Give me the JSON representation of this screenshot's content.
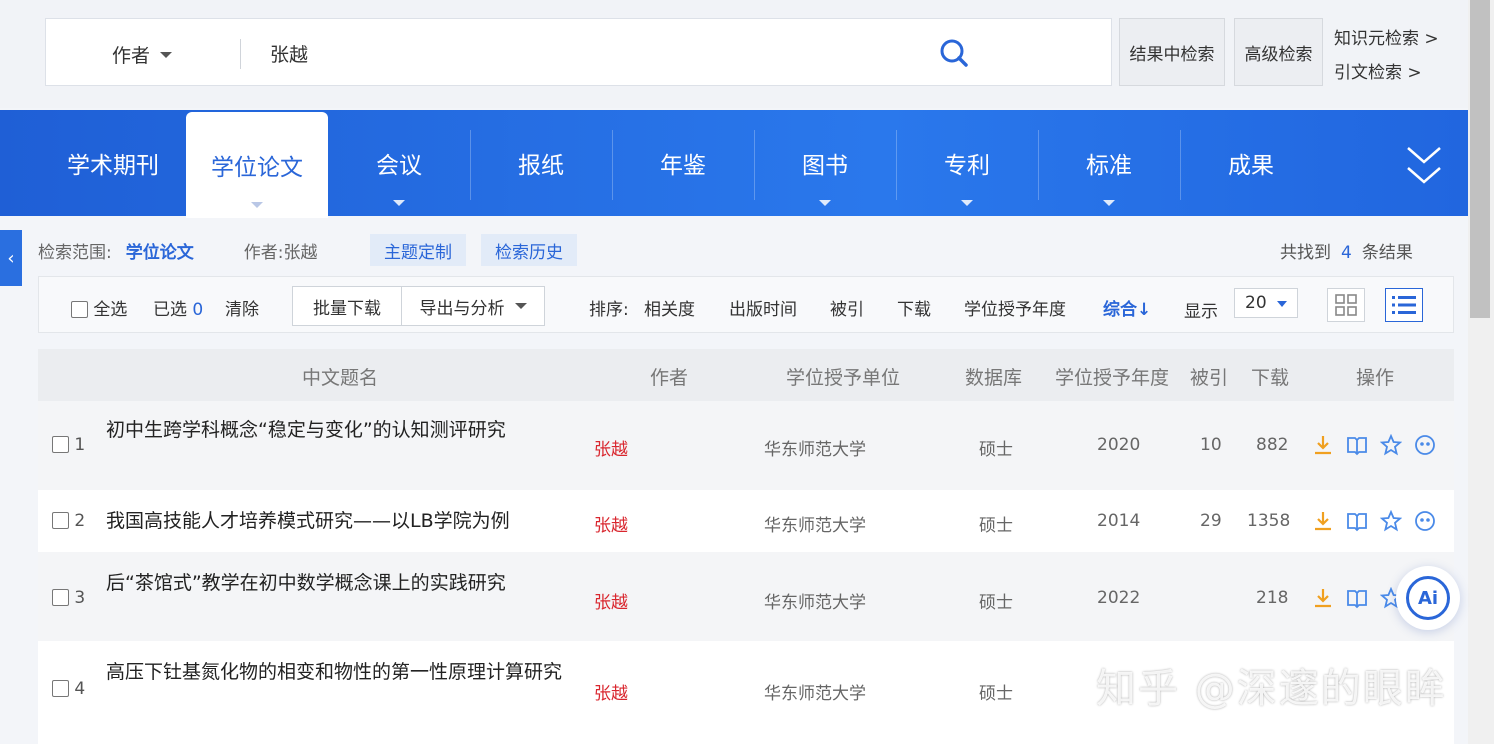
{
  "search": {
    "field": "作者",
    "query": "张越",
    "in_results_button": "结果中检索",
    "advanced_button": "高级检索",
    "knowledge_search_link": "知识元检索 >",
    "citation_search_link": "引文检索 >"
  },
  "tabs": [
    {
      "label": "学术期刊",
      "active": false
    },
    {
      "label": "学位论文",
      "active": true
    },
    {
      "label": "会议",
      "active": false
    },
    {
      "label": "报纸",
      "active": false
    },
    {
      "label": "年鉴",
      "active": false
    },
    {
      "label": "图书",
      "active": false
    },
    {
      "label": "专利",
      "active": false
    },
    {
      "label": "标准",
      "active": false
    },
    {
      "label": "成果",
      "active": false
    }
  ],
  "scope": {
    "label": "检索范围:",
    "value": "学位论文",
    "author_filter": "作者:张越",
    "topic_button": "主题定制",
    "history_button": "检索历史",
    "found_prefix": "共找到",
    "found_count": "4",
    "found_suffix": "条结果"
  },
  "toolbar": {
    "select_all": "全选",
    "selected_label": "已选",
    "selected_count": "0",
    "clear": "清除",
    "batch_download": "批量下载",
    "export_analysis": "导出与分析",
    "sort_label": "排序:",
    "sort_options": [
      "相关度",
      "出版时间",
      "被引",
      "下载",
      "学位授予年度",
      "综合"
    ],
    "sort_active": "综合",
    "display_label": "显示",
    "page_size": "20"
  },
  "table": {
    "headers": [
      "中文题名",
      "作者",
      "学位授予单位",
      "数据库",
      "学位授予年度",
      "被引",
      "下载",
      "操作"
    ],
    "rows": [
      {
        "num": "1",
        "title": "初中生跨学科概念“稳定与变化”的认知测评研究",
        "author": "张越",
        "unit": "华东师范大学",
        "db": "硕士",
        "year": "2020",
        "cited": "10",
        "downloads": "882"
      },
      {
        "num": "2",
        "title": "我国高技能人才培养模式研究——以LB学院为例",
        "author": "张越",
        "unit": "华东师范大学",
        "db": "硕士",
        "year": "2014",
        "cited": "29",
        "downloads": "1358"
      },
      {
        "num": "3",
        "title": "后“茶馆式”教学在初中数学概念课上的实践研究",
        "author": "张越",
        "unit": "华东师范大学",
        "db": "硕士",
        "year": "2022",
        "cited": "",
        "downloads": "218"
      },
      {
        "num": "4",
        "title": "高压下钍基氮化物的相变和物性的第一性原理计算研究",
        "author": "张越",
        "unit": "华东师范大学",
        "db": "硕士",
        "year": "",
        "cited": "",
        "downloads": ""
      }
    ]
  },
  "ai_badge": "Ai",
  "watermark": "知乎 @深邃的眼眸",
  "colors": {
    "accent": "#2a66d8",
    "author_red": "#d9262e",
    "download_orange": "#f0a020"
  }
}
